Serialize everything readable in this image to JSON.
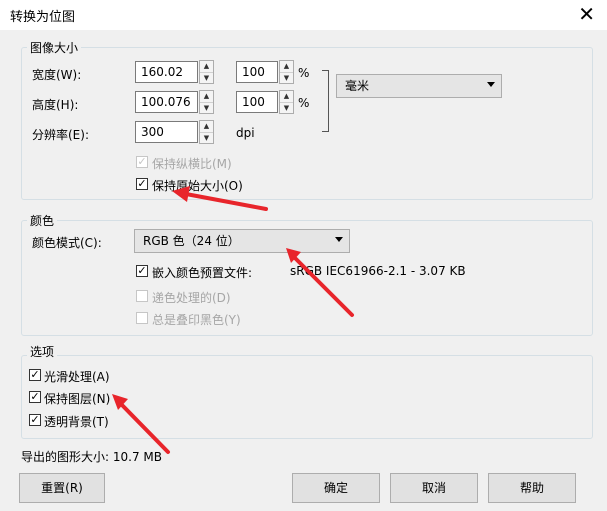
{
  "window": {
    "title": "转换为位图",
    "close_glyph": "✕"
  },
  "image_size": {
    "legend": "图像大小",
    "width_label": "宽度(W):",
    "width_value": "160.02",
    "width_pct": "100",
    "height_label": "高度(H):",
    "height_value": "100.076",
    "height_pct": "100",
    "pct_sign": "%",
    "unit": "毫米",
    "resolution_label": "分辨率(E):",
    "resolution_value": "300",
    "resolution_unit": "dpi",
    "keep_ratio_label": "保持纵横比(M)",
    "keep_ratio_checked": true,
    "keep_original_label": "保持原始大小(O)",
    "keep_original_checked": true
  },
  "color": {
    "legend": "颜色",
    "mode_label": "颜色模式(C):",
    "mode_value": "RGB 色（24 位）",
    "embed_profile_label": "嵌入颜色预置文件:",
    "embed_profile_checked": true,
    "profile_info": "sRGB IEC61966-2.1 - 3.07 KB",
    "dither_label": "递色处理的(D)",
    "overprint_black_label": "总是叠印黑色(Y)"
  },
  "options": {
    "legend": "选项",
    "smooth_label": "光滑处理(A)",
    "smooth_checked": true,
    "keep_layers_label": "保持图层(N)",
    "keep_layers_checked": true,
    "transparent_bg_label": "透明背景(T)",
    "transparent_bg_checked": true
  },
  "export_size": "导出的图形大小: 10.7 MB",
  "buttons": {
    "reset": "重置(R)",
    "ok": "确定",
    "cancel": "取消",
    "help": "帮助"
  },
  "colors": {
    "annotation_arrow": "#e8252b",
    "dialog_bg": "#f0f0f0"
  }
}
